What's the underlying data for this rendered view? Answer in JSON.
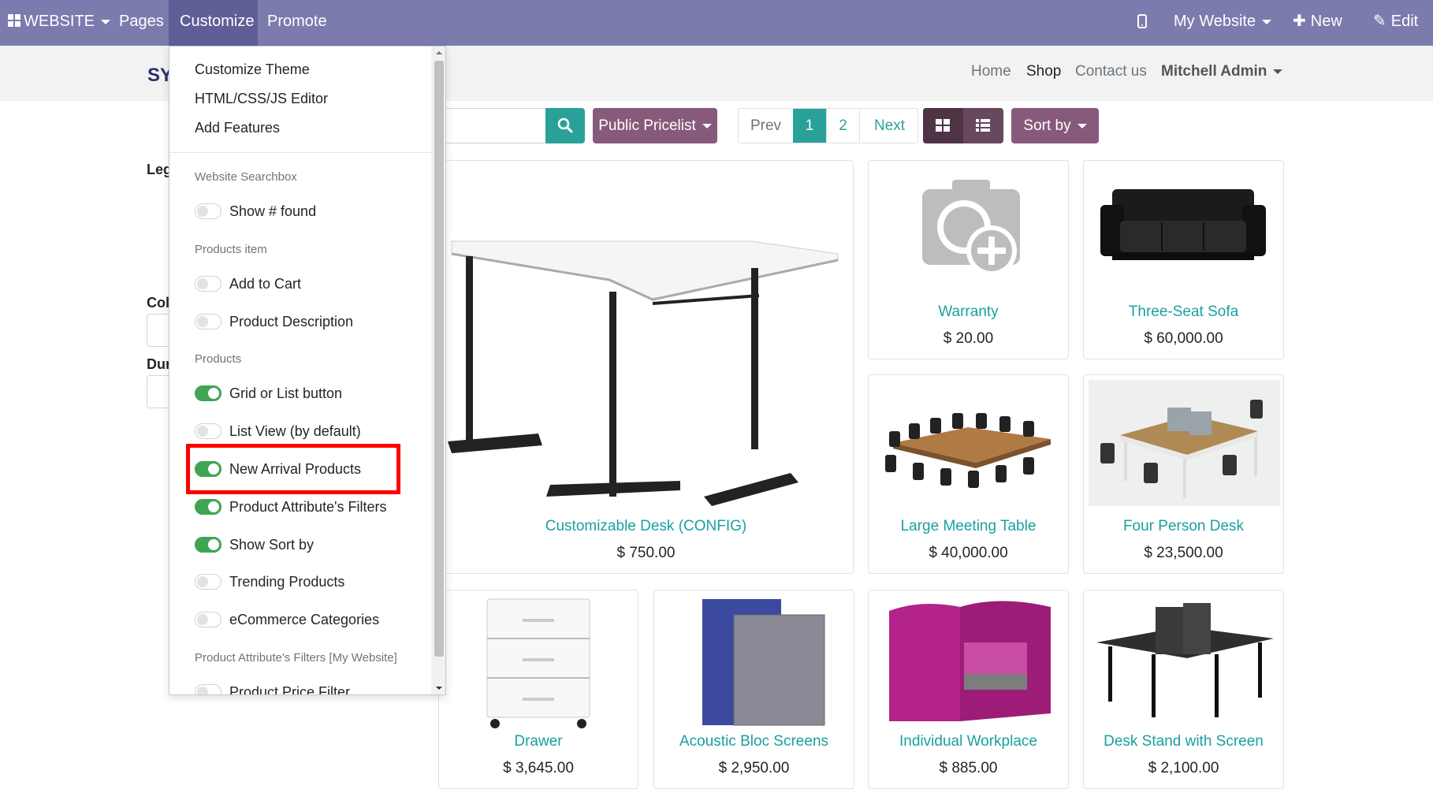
{
  "topbar": {
    "website_label": "WEBSITE",
    "pages_label": "Pages",
    "customize_label": "Customize",
    "promote_label": "Promote",
    "my_website_label": "My Website",
    "new_label": "New",
    "edit_label": "Edit",
    "bg_color": "#7c7bad"
  },
  "navbar": {
    "logo_text": "SY",
    "links": [
      "Home",
      "Shop",
      "Contact us"
    ],
    "user_label": "Mitchell Admin"
  },
  "sidebar": {
    "label1": "Leg",
    "label2": "Col",
    "label3": "Dur"
  },
  "toolbar": {
    "pricelist_label": "Public Pricelist",
    "pager_prev": "Prev",
    "pager_page1": "1",
    "pager_page2": "2",
    "pager_next": "Next",
    "sort_label": "Sort by"
  },
  "products": [
    {
      "name": "Customizable Desk (CONFIG)",
      "price": "$ 750.00"
    },
    {
      "name": "Warranty",
      "price": "$ 20.00"
    },
    {
      "name": "Three-Seat Sofa",
      "price": "$ 60,000.00"
    },
    {
      "name": "Large Meeting Table",
      "price": "$ 40,000.00"
    },
    {
      "name": "Four Person Desk",
      "price": "$ 23,500.00"
    },
    {
      "name": "Drawer",
      "price": "$ 3,645.00"
    },
    {
      "name": "Acoustic Bloc Screens",
      "price": "$ 2,950.00"
    },
    {
      "name": "Individual Workplace",
      "price": "$ 885.00"
    },
    {
      "name": "Desk Stand with Screen",
      "price": "$ 2,100.00"
    }
  ],
  "customize_menu": {
    "items": [
      "Customize Theme",
      "HTML/CSS/JS Editor",
      "Add Features"
    ],
    "sections": [
      "Website Searchbox",
      "Products item",
      "Products",
      "Product Attribute's Filters [My Website]"
    ],
    "options": [
      {
        "label": "Show # found",
        "on": false
      },
      {
        "label": "Add to Cart",
        "on": false
      },
      {
        "label": "Product Description",
        "on": false
      },
      {
        "label": "Grid or List button",
        "on": true
      },
      {
        "label": "List View (by default)",
        "on": false
      },
      {
        "label": "New Arrival Products",
        "on": true
      },
      {
        "label": "Product Attribute's Filters",
        "on": true
      },
      {
        "label": "Show Sort by",
        "on": true
      },
      {
        "label": "Trending Products",
        "on": false
      },
      {
        "label": "eCommerce Categories",
        "on": false
      },
      {
        "label": "Product Price Filter",
        "on": false
      }
    ]
  },
  "colors": {
    "accent_teal": "#2aa198",
    "brand_purple": "#875a7b",
    "toggle_on": "#3fa552",
    "highlight": "#ff0000"
  }
}
